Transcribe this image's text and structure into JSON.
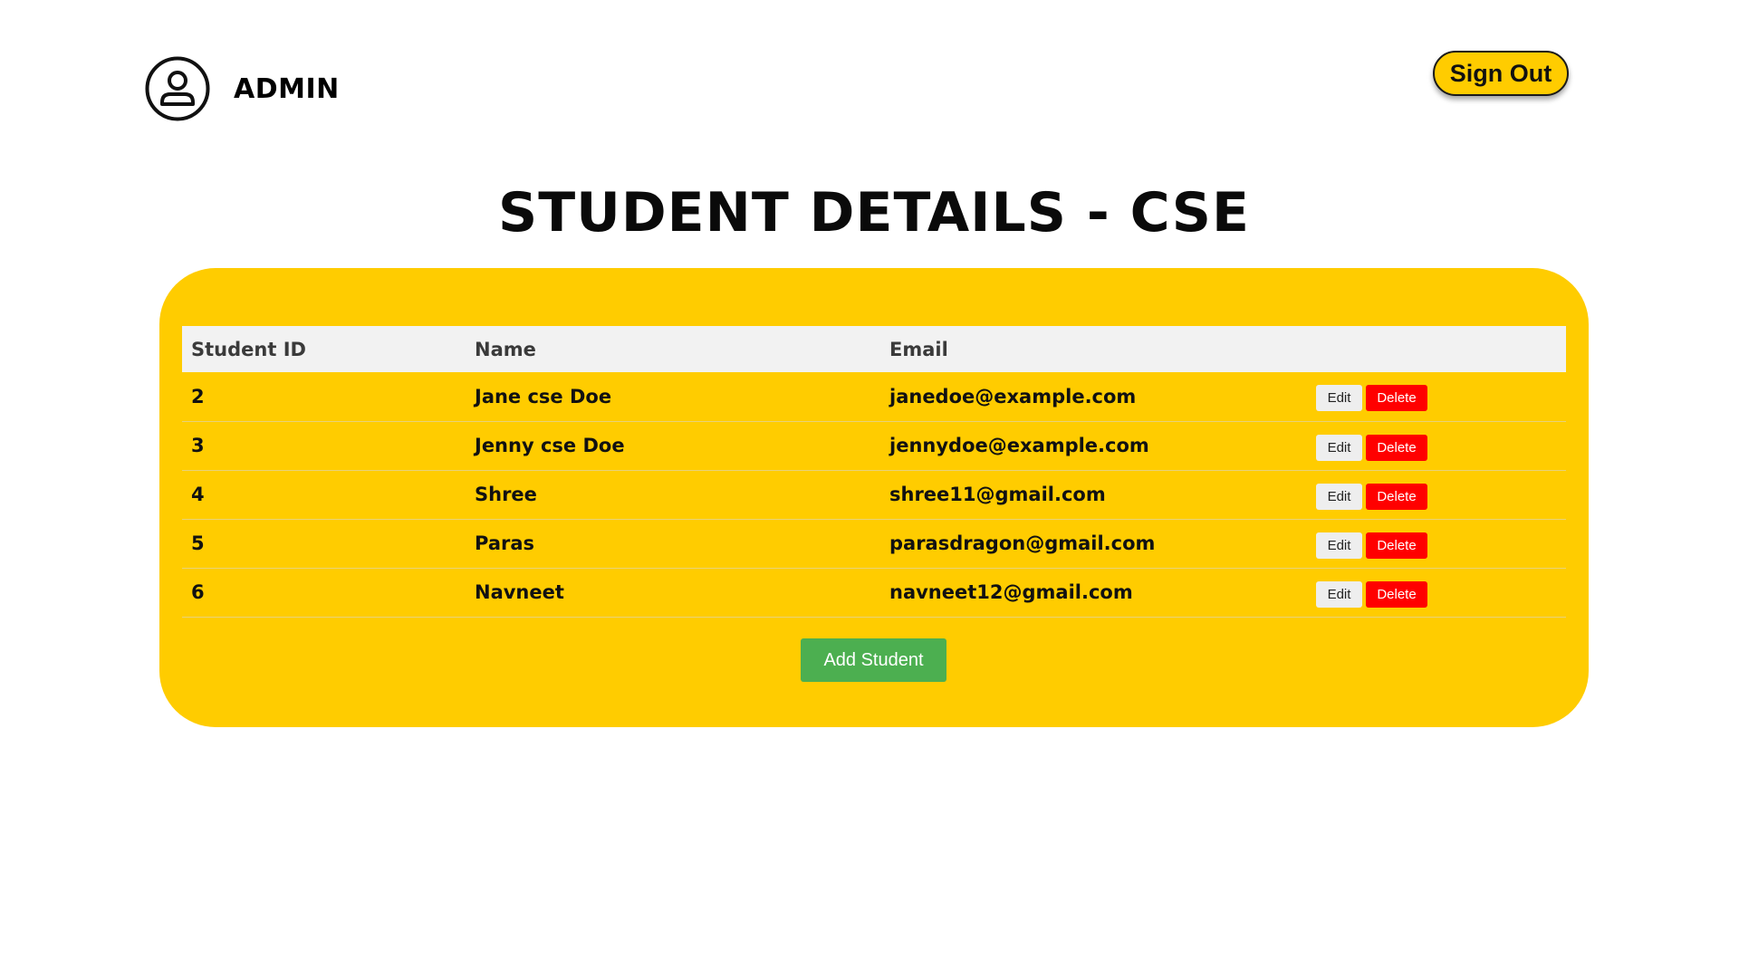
{
  "header": {
    "user_label": "ADMIN",
    "sign_out_label": "Sign Out"
  },
  "page": {
    "title": "STUDENT DETAILS - CSE"
  },
  "table": {
    "headers": [
      "Student ID",
      "Name",
      "Email",
      ""
    ],
    "rows": [
      {
        "id": "2",
        "name": "Jane cse Doe",
        "email": "janedoe@example.com"
      },
      {
        "id": "3",
        "name": "Jenny cse Doe",
        "email": "jennydoe@example.com"
      },
      {
        "id": "4",
        "name": "Shree",
        "email": "shree11@gmail.com"
      },
      {
        "id": "5",
        "name": "Paras",
        "email": "parasdragon@gmail.com"
      },
      {
        "id": "6",
        "name": "Navneet",
        "email": "navneet12@gmail.com"
      }
    ],
    "edit_label": "Edit",
    "delete_label": "Delete"
  },
  "actions": {
    "add_student_label": "Add Student"
  },
  "colors": {
    "accent": "#ffcc00",
    "delete": "#ff0000",
    "add": "#4caf50",
    "header_bg": "#f2f2f2"
  },
  "icons": {
    "avatar": "user-circle-icon"
  }
}
